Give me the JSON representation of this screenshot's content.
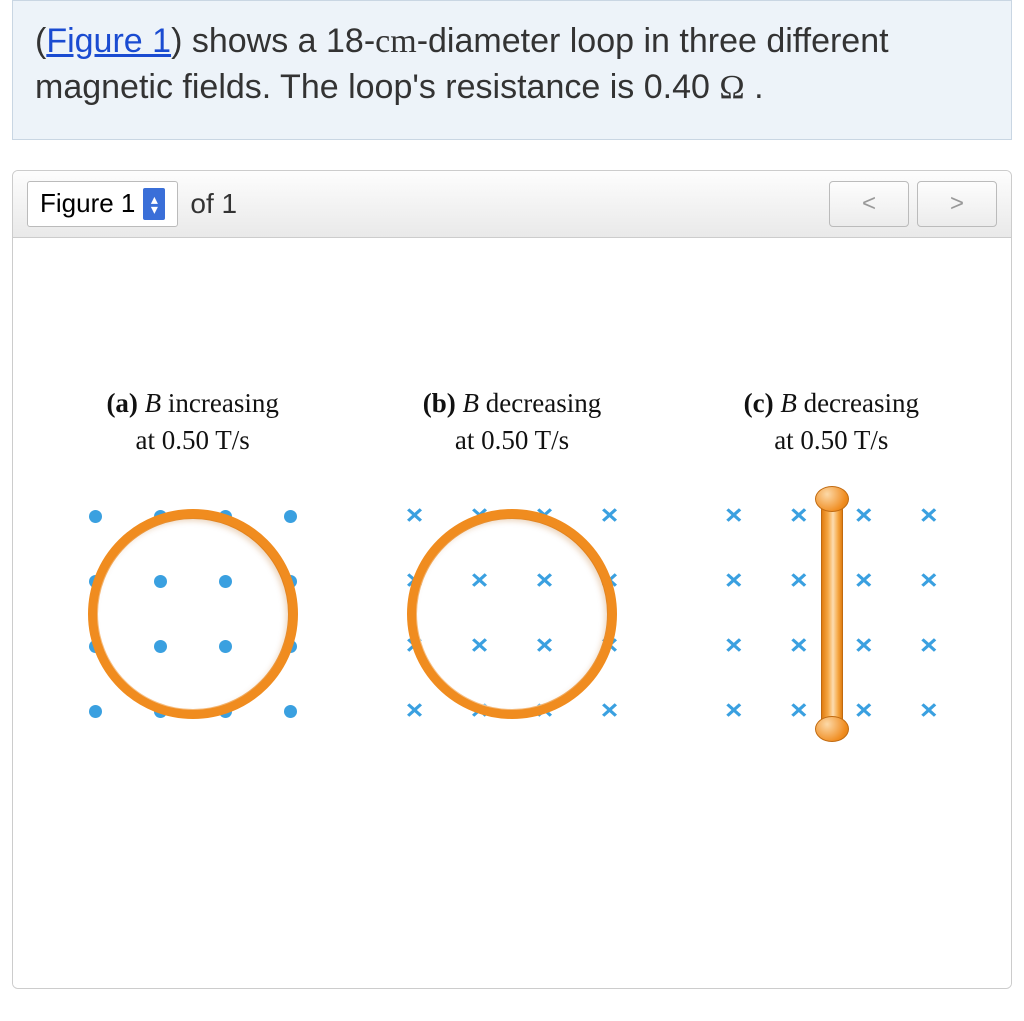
{
  "problem": {
    "figure_link": "Figure 1",
    "text_before_link": "(",
    "text_after_link": ") shows a 18-",
    "cm_unit": "cm",
    "text_after_cm": "-diameter loop in three different magnetic fields. The loop's resistance is 0.40 ",
    "omega": "Ω",
    "period": " ."
  },
  "figure_selector": {
    "current": "Figure 1",
    "of_label": "of 1"
  },
  "panels": [
    {
      "label": "(a)",
      "desc_pre": "B",
      "desc_post": " increasing",
      "sub": "at 0.50 T/s",
      "field": "out",
      "shape": "loop"
    },
    {
      "label": "(b)",
      "desc_pre": "B",
      "desc_post": " decreasing",
      "sub": "at 0.50 T/s",
      "field": "in",
      "shape": "loop"
    },
    {
      "label": "(c)",
      "desc_pre": "B",
      "desc_post": " decreasing",
      "sub": "at 0.50 T/s",
      "field": "in",
      "shape": "side"
    }
  ],
  "chart_data": {
    "type": "diagram",
    "loop_diameter_cm": 18,
    "resistance_ohm": 0.4,
    "cases": [
      {
        "id": "a",
        "B_direction": "out_of_page",
        "dBdt_T_per_s": 0.5,
        "changing": "increasing",
        "loop_orientation": "face_on"
      },
      {
        "id": "b",
        "B_direction": "into_page",
        "dBdt_T_per_s": 0.5,
        "changing": "decreasing",
        "loop_orientation": "face_on"
      },
      {
        "id": "c",
        "B_direction": "into_page",
        "dBdt_T_per_s": 0.5,
        "changing": "decreasing",
        "loop_orientation": "edge_on"
      }
    ]
  }
}
